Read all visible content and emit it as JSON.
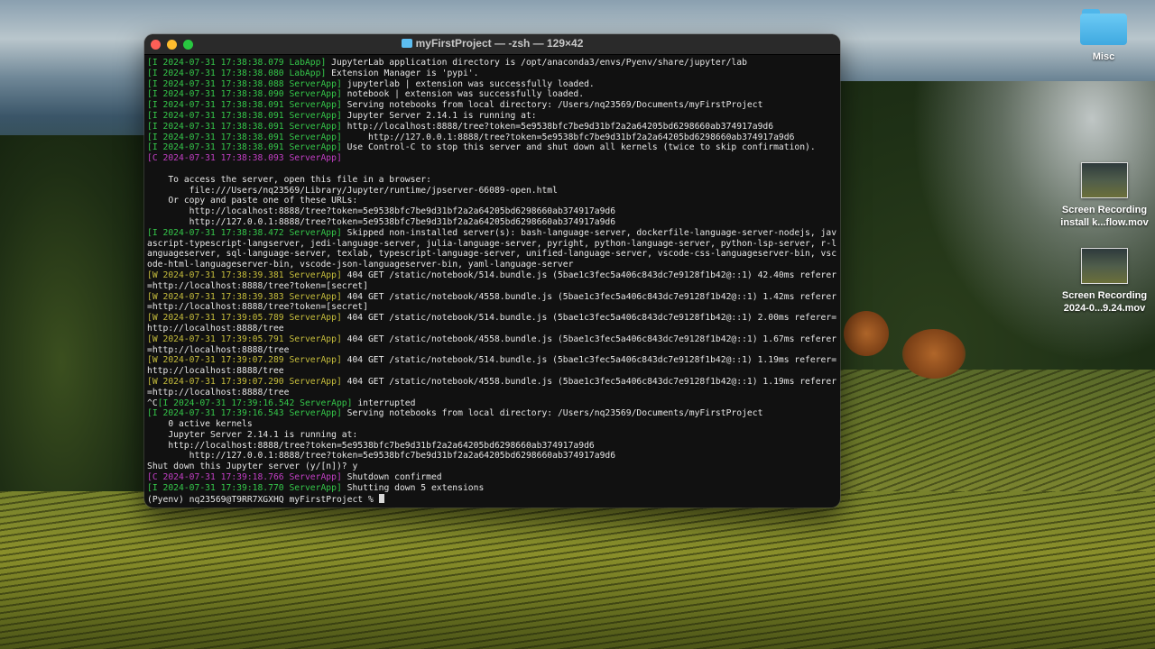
{
  "desktop": {
    "icons": [
      {
        "label": "Misc",
        "kind": "folder-icon"
      },
      {
        "label_line1": "Screen Recording",
        "label_line2": "install k...flow.mov",
        "kind": "video-thumbnail"
      },
      {
        "label_line1": "Screen Recording",
        "label_line2": "2024-0...9.24.mov",
        "kind": "video-thumbnail"
      }
    ]
  },
  "terminal": {
    "title": "myFirstProject — -zsh — 129×42",
    "colors": {
      "info": "#35c74a",
      "warn": "#c6bd3c",
      "crit": "#c33fc5",
      "text": "#e6e6e6",
      "bg": "#111111"
    },
    "lines": [
      {
        "segments": [
          {
            "c": "g",
            "t": "[I 2024-07-31 17:38:38.079 LabApp]"
          },
          {
            "t": " JupyterLab application directory is /opt/anaconda3/envs/Pyenv/share/jupyter/lab"
          }
        ]
      },
      {
        "segments": [
          {
            "c": "g",
            "t": "[I 2024-07-31 17:38:38.080 LabApp]"
          },
          {
            "t": " Extension Manager is 'pypi'."
          }
        ]
      },
      {
        "segments": [
          {
            "c": "g",
            "t": "[I 2024-07-31 17:38:38.088 ServerApp]"
          },
          {
            "t": " jupyterlab | extension was successfully loaded."
          }
        ]
      },
      {
        "segments": [
          {
            "c": "g",
            "t": "[I 2024-07-31 17:38:38.090 ServerApp]"
          },
          {
            "t": " notebook | extension was successfully loaded."
          }
        ]
      },
      {
        "segments": [
          {
            "c": "g",
            "t": "[I 2024-07-31 17:38:38.091 ServerApp]"
          },
          {
            "t": " Serving notebooks from local directory: /Users/nq23569/Documents/myFirstProject"
          }
        ]
      },
      {
        "segments": [
          {
            "c": "g",
            "t": "[I 2024-07-31 17:38:38.091 ServerApp]"
          },
          {
            "t": " Jupyter Server 2.14.1 is running at:"
          }
        ]
      },
      {
        "segments": [
          {
            "c": "g",
            "t": "[I 2024-07-31 17:38:38.091 ServerApp]"
          },
          {
            "t": " http://localhost:8888/tree?token=5e9538bfc7be9d31bf2a2a64205bd6298660ab374917a9d6"
          }
        ]
      },
      {
        "segments": [
          {
            "c": "g",
            "t": "[I 2024-07-31 17:38:38.091 ServerApp]"
          },
          {
            "t": "     http://127.0.0.1:8888/tree?token=5e9538bfc7be9d31bf2a2a64205bd6298660ab374917a9d6"
          }
        ]
      },
      {
        "segments": [
          {
            "c": "g",
            "t": "[I 2024-07-31 17:38:38.091 ServerApp]"
          },
          {
            "t": " Use Control-C to stop this server and shut down all kernels (twice to skip confirmation)."
          }
        ]
      },
      {
        "segments": [
          {
            "c": "m",
            "t": "[C 2024-07-31 17:38:38.093 ServerApp]"
          }
        ]
      },
      {
        "segments": [
          {
            "t": " "
          }
        ]
      },
      {
        "segments": [
          {
            "t": "    To access the server, open this file in a browser:"
          }
        ]
      },
      {
        "segments": [
          {
            "t": "        file:///Users/nq23569/Library/Jupyter/runtime/jpserver-66089-open.html"
          }
        ]
      },
      {
        "segments": [
          {
            "t": "    Or copy and paste one of these URLs:"
          }
        ]
      },
      {
        "segments": [
          {
            "t": "        http://localhost:8888/tree?token=5e9538bfc7be9d31bf2a2a64205bd6298660ab374917a9d6"
          }
        ]
      },
      {
        "segments": [
          {
            "t": "        http://127.0.0.1:8888/tree?token=5e9538bfc7be9d31bf2a2a64205bd6298660ab374917a9d6"
          }
        ]
      },
      {
        "segments": [
          {
            "c": "g",
            "t": "[I 2024-07-31 17:38:38.472 ServerApp]"
          },
          {
            "t": " Skipped non-installed server(s): bash-language-server, dockerfile-language-server-nodejs, javascript-typescript-langserver, jedi-language-server, julia-language-server, pyright, python-language-server, python-lsp-server, r-languageserver, sql-language-server, texlab, typescript-language-server, unified-language-server, vscode-css-languageserver-bin, vscode-html-languageserver-bin, vscode-json-languageserver-bin, yaml-language-server"
          }
        ]
      },
      {
        "segments": [
          {
            "c": "y",
            "t": "[W 2024-07-31 17:38:39.381 ServerApp]"
          },
          {
            "t": " 404 GET /static/notebook/514.bundle.js (5bae1c3fec5a406c843dc7e9128f1b42@::1) 42.40ms referer=http://localhost:8888/tree?token=[secret]"
          }
        ]
      },
      {
        "segments": [
          {
            "c": "y",
            "t": "[W 2024-07-31 17:38:39.383 ServerApp]"
          },
          {
            "t": " 404 GET /static/notebook/4558.bundle.js (5bae1c3fec5a406c843dc7e9128f1b42@::1) 1.42ms referer=http://localhost:8888/tree?token=[secret]"
          }
        ]
      },
      {
        "segments": [
          {
            "c": "y",
            "t": "[W 2024-07-31 17:39:05.789 ServerApp]"
          },
          {
            "t": " 404 GET /static/notebook/514.bundle.js (5bae1c3fec5a406c843dc7e9128f1b42@::1) 2.00ms referer=http://localhost:8888/tree"
          }
        ]
      },
      {
        "segments": [
          {
            "c": "y",
            "t": "[W 2024-07-31 17:39:05.791 ServerApp]"
          },
          {
            "t": " 404 GET /static/notebook/4558.bundle.js (5bae1c3fec5a406c843dc7e9128f1b42@::1) 1.67ms referer=http://localhost:8888/tree"
          }
        ]
      },
      {
        "segments": [
          {
            "c": "y",
            "t": "[W 2024-07-31 17:39:07.289 ServerApp]"
          },
          {
            "t": " 404 GET /static/notebook/514.bundle.js (5bae1c3fec5a406c843dc7e9128f1b42@::1) 1.19ms referer=http://localhost:8888/tree"
          }
        ]
      },
      {
        "segments": [
          {
            "c": "y",
            "t": "[W 2024-07-31 17:39:07.290 ServerApp]"
          },
          {
            "t": " 404 GET /static/notebook/4558.bundle.js (5bae1c3fec5a406c843dc7e9128f1b42@::1) 1.19ms referer=http://localhost:8888/tree"
          }
        ]
      },
      {
        "segments": [
          {
            "t": "^C"
          },
          {
            "c": "g",
            "t": "[I 2024-07-31 17:39:16.542 ServerApp]"
          },
          {
            "t": " interrupted"
          }
        ]
      },
      {
        "segments": [
          {
            "c": "g",
            "t": "[I 2024-07-31 17:39:16.543 ServerApp]"
          },
          {
            "t": " Serving notebooks from local directory: /Users/nq23569/Documents/myFirstProject"
          }
        ]
      },
      {
        "segments": [
          {
            "t": "    0 active kernels"
          }
        ]
      },
      {
        "segments": [
          {
            "t": "    Jupyter Server 2.14.1 is running at:"
          }
        ]
      },
      {
        "segments": [
          {
            "t": "    http://localhost:8888/tree?token=5e9538bfc7be9d31bf2a2a64205bd6298660ab374917a9d6"
          }
        ]
      },
      {
        "segments": [
          {
            "t": "        http://127.0.0.1:8888/tree?token=5e9538bfc7be9d31bf2a2a64205bd6298660ab374917a9d6"
          }
        ]
      },
      {
        "segments": [
          {
            "t": "Shut down this Jupyter server (y/[n])? y"
          }
        ]
      },
      {
        "segments": [
          {
            "c": "m",
            "t": "[C 2024-07-31 17:39:18.766 ServerApp]"
          },
          {
            "t": " Shutdown confirmed"
          }
        ]
      },
      {
        "segments": [
          {
            "c": "g",
            "t": "[I 2024-07-31 17:39:18.770 ServerApp]"
          },
          {
            "t": " Shutting down 5 extensions"
          }
        ]
      }
    ],
    "prompt": "(Pyenv) nq23569@T9RR7XGXHQ myFirstProject % "
  }
}
